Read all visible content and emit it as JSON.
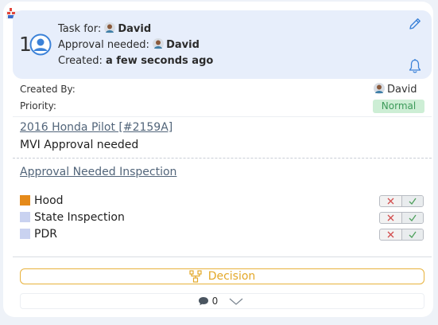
{
  "task": {
    "number": "1",
    "task_for_label": "Task for:",
    "task_for_name": "David",
    "approval_label": "Approval needed:",
    "approval_name": "David",
    "created_label": "Created:",
    "created_value": "a few seconds ago"
  },
  "details": {
    "created_by_label": "Created By:",
    "created_by_name": "David",
    "priority_label": "Priority:",
    "priority_value": "Normal"
  },
  "vehicle": {
    "link": "2016 Honda Pilot [#2159A]",
    "note": "MVI Approval needed"
  },
  "inspection": {
    "link": "Approval Needed Inspection",
    "items": [
      {
        "label": "Hood",
        "color": "#e58a1a"
      },
      {
        "label": "State Inspection",
        "color": "#c9d2f0"
      },
      {
        "label": "PDR",
        "color": "#c9d2f0"
      }
    ]
  },
  "actions": {
    "decision_label": "Decision",
    "comment_count": "0"
  },
  "colors": {
    "accent": "#e3a829",
    "priority_bg": "#cdeed5",
    "priority_text": "#3c9a59",
    "header_bg": "#e7eefb"
  },
  "icons": [
    "logo-icon",
    "user-icon",
    "pencil-icon",
    "bell-icon",
    "close-icon",
    "check-icon",
    "decision-icon",
    "comment-icon",
    "chevron-down-icon"
  ]
}
